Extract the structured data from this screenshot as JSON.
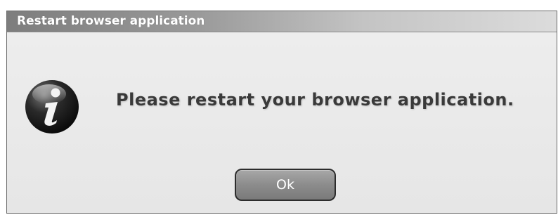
{
  "dialog": {
    "title": "Restart browser application",
    "message": "Please restart your browser application.",
    "icon": "info-icon",
    "ok_label": "Ok"
  }
}
